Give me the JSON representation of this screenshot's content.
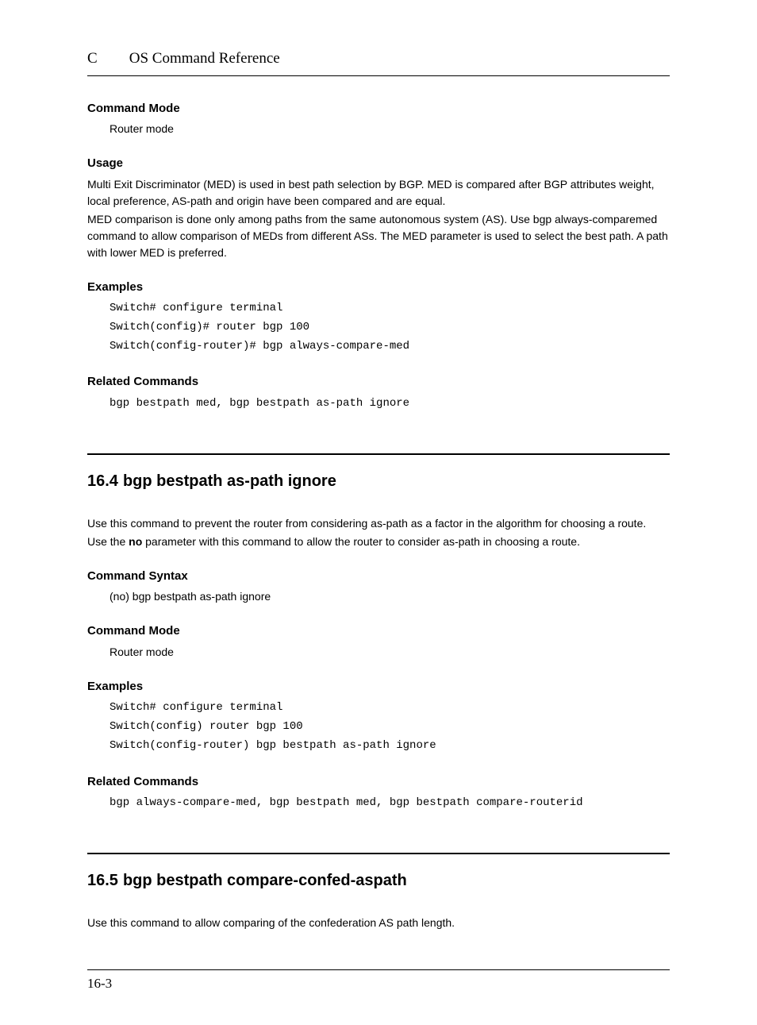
{
  "header": {
    "appendix": "C",
    "title": "OS Command Reference"
  },
  "s1": {
    "cmdMode": {
      "h": "Command Mode",
      "t": "Router mode"
    },
    "usage": {
      "h": "Usage",
      "p1": "Multi Exit Discriminator (MED) is used in best path selection by BGP. MED is compared after BGP attributes weight, local preference, AS-path and origin have been compared and are equal.",
      "p2": "MED comparison is done only among paths from the same autonomous system (AS). Use bgp always-comparemed command to allow comparison of MEDs from different ASs. The MED parameter is used to select the best path. A path with lower MED is preferred."
    },
    "examples": {
      "h": "Examples",
      "code": "Switch# configure terminal\nSwitch(config)# router bgp 100\nSwitch(config-router)# bgp always-compare-med"
    },
    "related": {
      "h": "Related Commands",
      "code": "bgp bestpath med, bgp bestpath as-path ignore"
    }
  },
  "s2": {
    "num": "16.4",
    "title": "bgp bestpath as-path ignore",
    "intro1": "Use this command to prevent the router from considering as-path as a factor in the algorithm for choosing a route.",
    "intro2a": "Use the ",
    "intro2b": "no",
    "intro2c": " parameter with this command to allow the router to consider as-path in choosing a route.",
    "syntax": {
      "h": "Command Syntax",
      "t": "(no) bgp bestpath as-path ignore"
    },
    "cmdMode": {
      "h": "Command Mode",
      "t": "Router mode"
    },
    "examples": {
      "h": "Examples",
      "code": "Switch# configure terminal\nSwitch(config) router bgp 100\nSwitch(config-router) bgp bestpath as-path ignore"
    },
    "related": {
      "h": "Related Commands",
      "code": "bgp always-compare-med, bgp bestpath med, bgp bestpath compare-routerid"
    }
  },
  "s3": {
    "num": "16.5",
    "title": "bgp bestpath compare-confed-aspath",
    "intro": "Use this command to allow comparing of the confederation AS path length."
  },
  "footer": {
    "page": "16-3"
  }
}
